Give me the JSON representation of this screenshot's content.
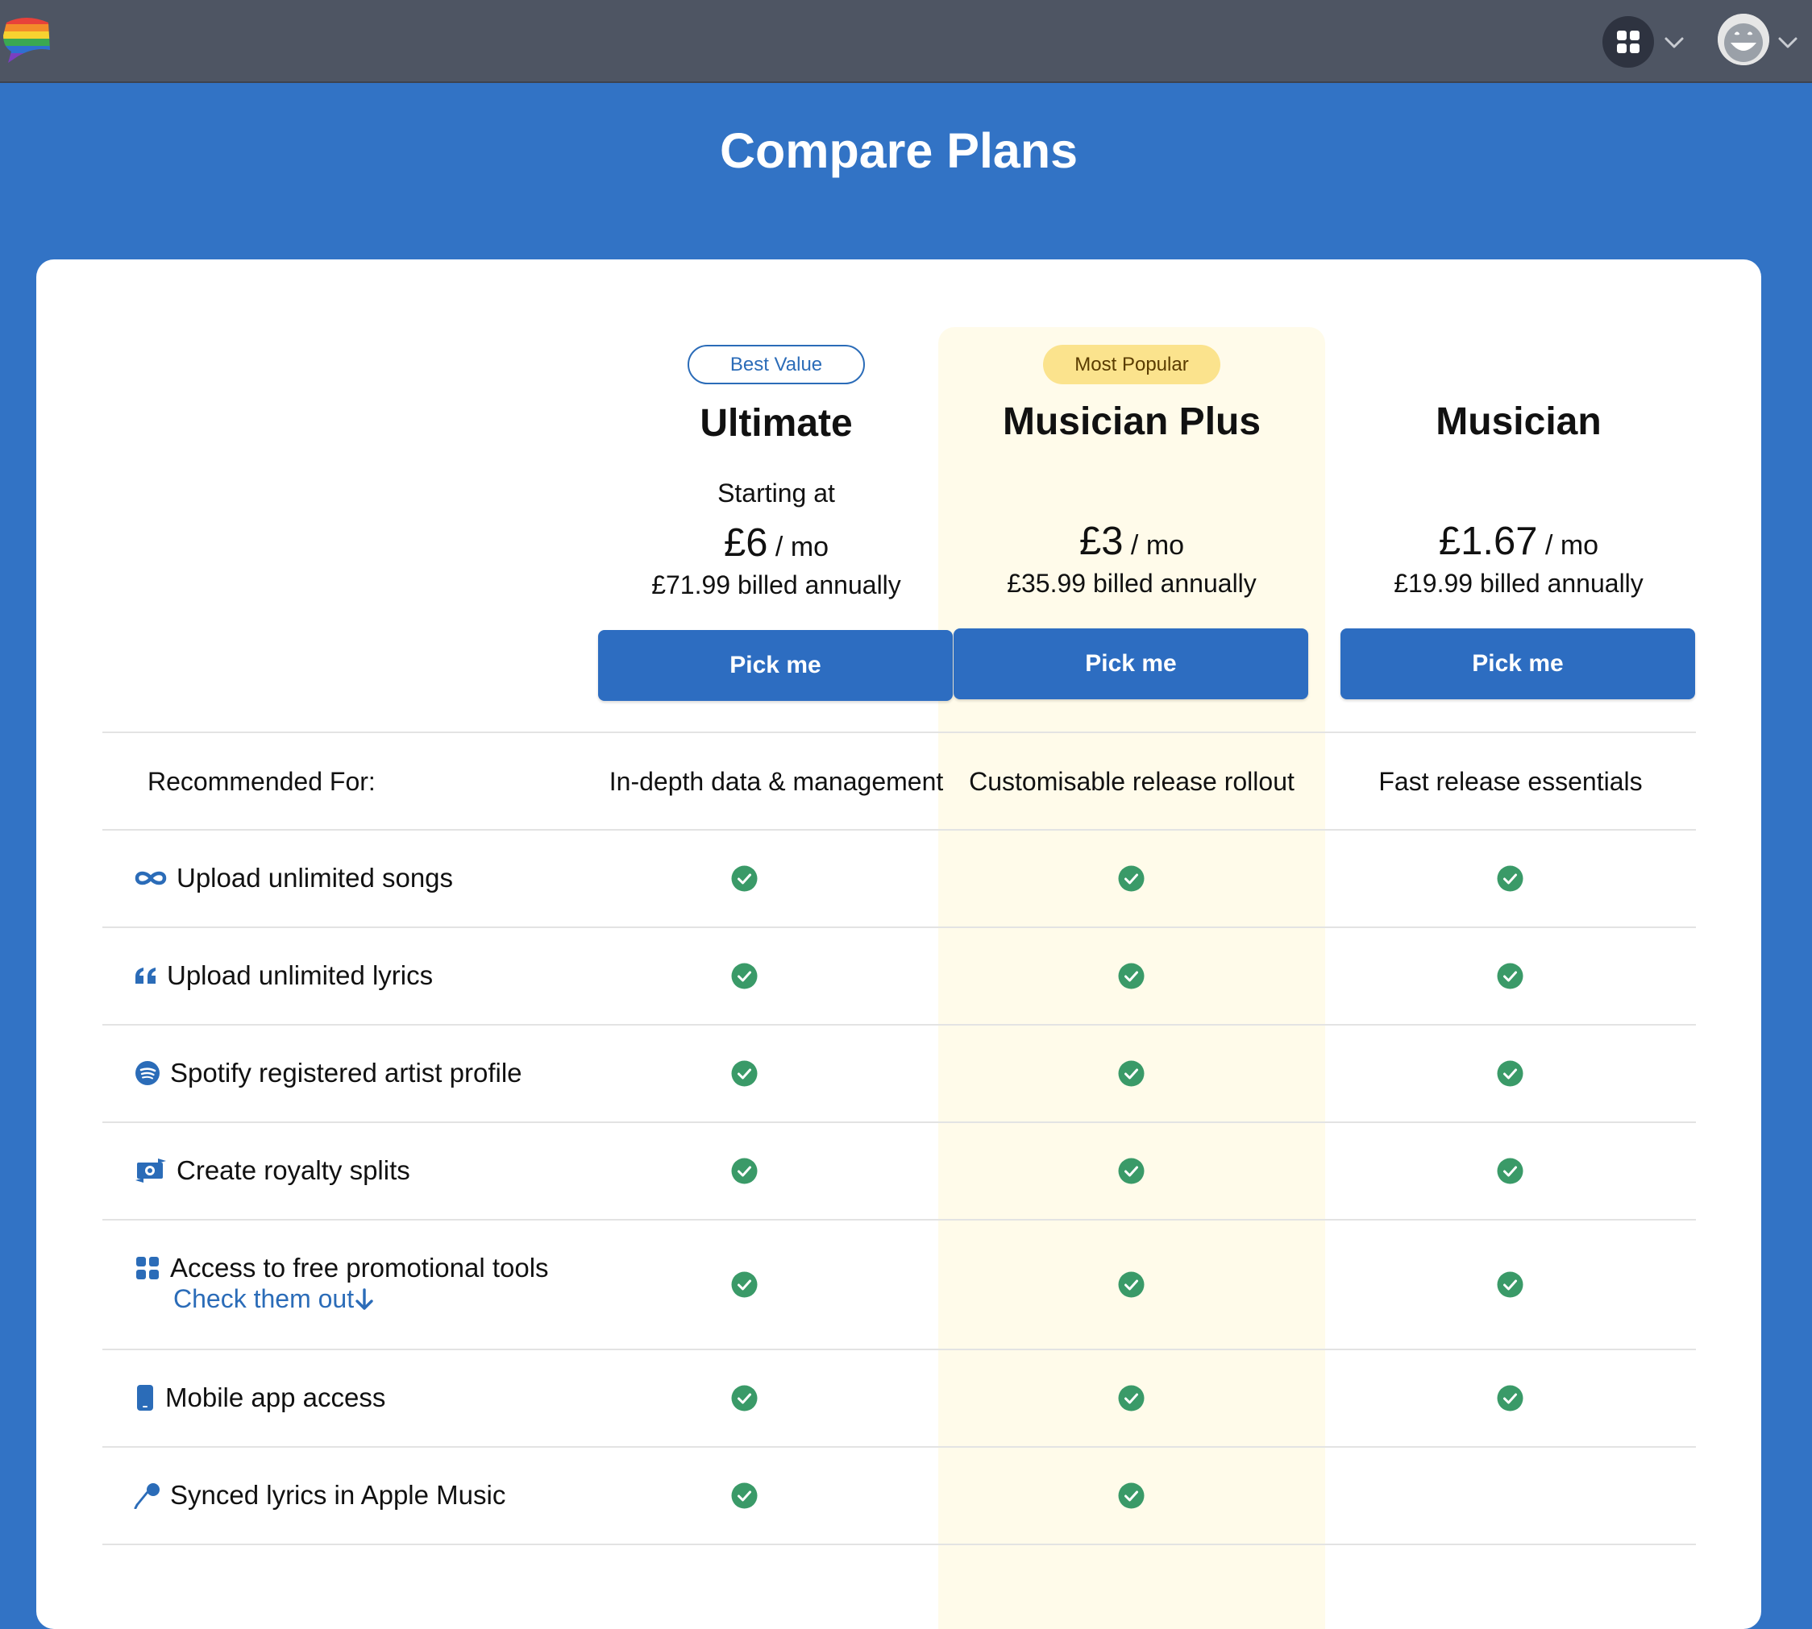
{
  "header": {
    "title": "Compare Plans"
  },
  "plans": [
    {
      "name": "Ultimate",
      "badge": "Best Value",
      "starting_at": "Starting at",
      "price": "£6",
      "per": "/ mo",
      "billed": "£71.99 billed annually",
      "button": "Pick me",
      "recommended": "In-depth data & management"
    },
    {
      "name": "Musician Plus",
      "badge": "Most Popular",
      "price": "£3",
      "per": "/ mo",
      "billed": "£35.99 billed annually",
      "button": "Pick me",
      "recommended": "Customisable release rollout"
    },
    {
      "name": "Musician",
      "price": "£1.67",
      "per": "/ mo",
      "billed": "£19.99 billed annually",
      "button": "Pick me",
      "recommended": "Fast release essentials"
    }
  ],
  "recommended_label": "Recommended For:",
  "features": [
    {
      "label": "Upload unlimited songs",
      "icon": "infinity-icon",
      "included": [
        true,
        true,
        true
      ]
    },
    {
      "label": "Upload unlimited lyrics",
      "icon": "quote-icon",
      "included": [
        true,
        true,
        true
      ]
    },
    {
      "label": "Spotify registered artist profile",
      "icon": "spotify-icon",
      "included": [
        true,
        true,
        true
      ]
    },
    {
      "label": "Create royalty splits",
      "icon": "money-exchange-icon",
      "included": [
        true,
        true,
        true
      ]
    },
    {
      "label": "Access to free promotional tools",
      "link": "Check them out",
      "icon": "grid-icon",
      "included": [
        true,
        true,
        true
      ]
    },
    {
      "label": "Mobile app access",
      "icon": "mobile-phone-icon",
      "included": [
        true,
        true,
        true
      ]
    },
    {
      "label": "Synced lyrics in Apple Music",
      "icon": "microphone-icon",
      "included": [
        true,
        true,
        false
      ]
    }
  ],
  "colors": {
    "brand_blue": "#3273c5",
    "button_blue": "#2d6dc1",
    "check_green": "#3a9a68",
    "highlight": "#fffbea",
    "badge_yellow": "#fbe38d",
    "topbar": "#4e5563"
  }
}
